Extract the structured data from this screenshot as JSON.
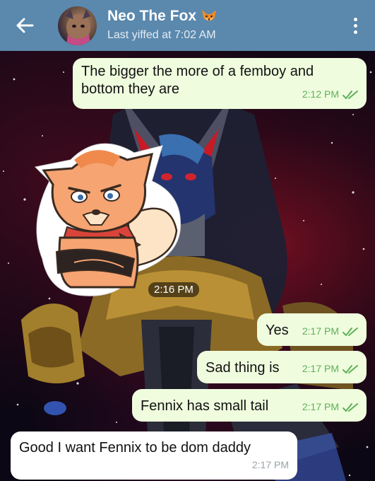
{
  "header": {
    "back_icon": "arrow-left-icon",
    "contact_name": "Neo The Fox",
    "status": "Last yiffed at 7:02 AM",
    "menu_icon": "more-vertical-icon",
    "background": "#5b88ad"
  },
  "messages": [
    {
      "direction": "out",
      "text_line1": "The bigger the more of a femboy and",
      "text_line2": "bottom they are",
      "time": "2:12 PM",
      "read": true
    },
    {
      "direction": "in",
      "type": "sticker",
      "sticker": "angry-fox-sticker",
      "time": "2:16 PM"
    },
    {
      "direction": "out",
      "text": "Yes",
      "time": "2:17 PM",
      "read": true
    },
    {
      "direction": "out",
      "text": "Sad thing is",
      "time": "2:17 PM",
      "read": true
    },
    {
      "direction": "out",
      "text": "Fennix has small tail",
      "time": "2:17 PM",
      "read": true
    },
    {
      "direction": "in",
      "text": "Good I want Fennix to be dom daddy",
      "time": "2:17 PM"
    }
  ],
  "colors": {
    "outgoing_bubble": "#effdde",
    "incoming_bubble": "#ffffff",
    "read_ticks": "#5faf5a"
  }
}
